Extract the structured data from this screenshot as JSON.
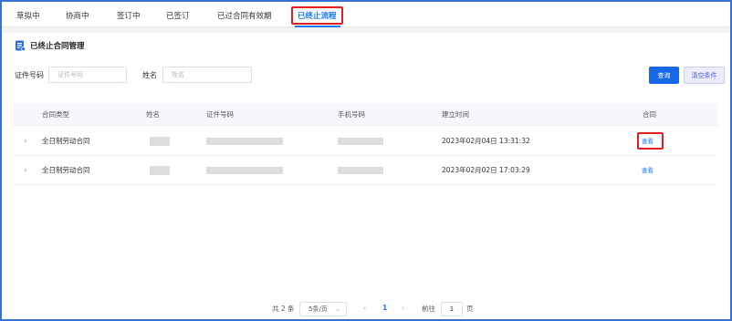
{
  "tabs": [
    {
      "label": "草拟中"
    },
    {
      "label": "协商中"
    },
    {
      "label": "签订中"
    },
    {
      "label": "已签订"
    },
    {
      "label": "已过合同有效期"
    },
    {
      "label": "已终止流程"
    }
  ],
  "active_tab": 5,
  "page": {
    "title": "已终止合同管理",
    "title_icon": "document-list-icon"
  },
  "filters": {
    "id_label": "证件号码",
    "id_placeholder": "证件号码",
    "id_value": "",
    "name_label": "姓名",
    "name_placeholder": "姓名",
    "name_value": ""
  },
  "buttons": {
    "query": "查询",
    "clear": "清空条件"
  },
  "table": {
    "columns": [
      "合同类型",
      "姓名",
      "证件号码",
      "手机号码",
      "建立时间",
      "合同"
    ],
    "rows": [
      {
        "contract_type": "全日制劳动合同",
        "created_at": "2023年02月04日 13:31:32",
        "action": "查看"
      },
      {
        "contract_type": "全日制劳动合同",
        "created_at": "2023年02月02日 17:03:29",
        "action": "查看"
      }
    ]
  },
  "pagination": {
    "total": "共 2 条",
    "page_size": "5条/页",
    "current_page": "1",
    "goto_label": "前往",
    "goto_value": "1",
    "page_unit": "页"
  },
  "colors": {
    "accent": "#1677ff",
    "highlight": "#e02020",
    "primary_button": "#1768e8"
  }
}
